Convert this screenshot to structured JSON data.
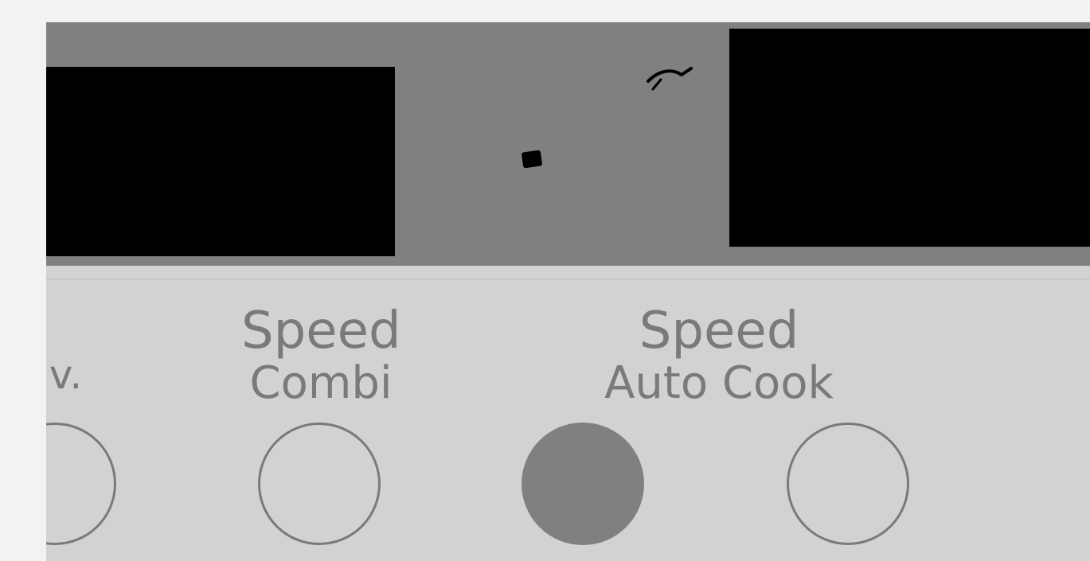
{
  "panel": {
    "colors": {
      "background": "#d2d2d2",
      "display_band": "#808080",
      "screen": "#000000",
      "label_text": "#7a7a7a",
      "filled_button": "#808080"
    },
    "labels": {
      "conv": "nv.",
      "speed_combi_line1": "Speed",
      "speed_combi_line2": "Combi",
      "speed_auto_line1": "Speed",
      "speed_auto_line2": "Auto Cook"
    },
    "buttons": [
      {
        "name": "conv",
        "style": "outline"
      },
      {
        "name": "speed-combi",
        "style": "outline"
      },
      {
        "name": "start",
        "style": "filled"
      },
      {
        "name": "speed-auto-cook",
        "style": "outline"
      }
    ]
  }
}
